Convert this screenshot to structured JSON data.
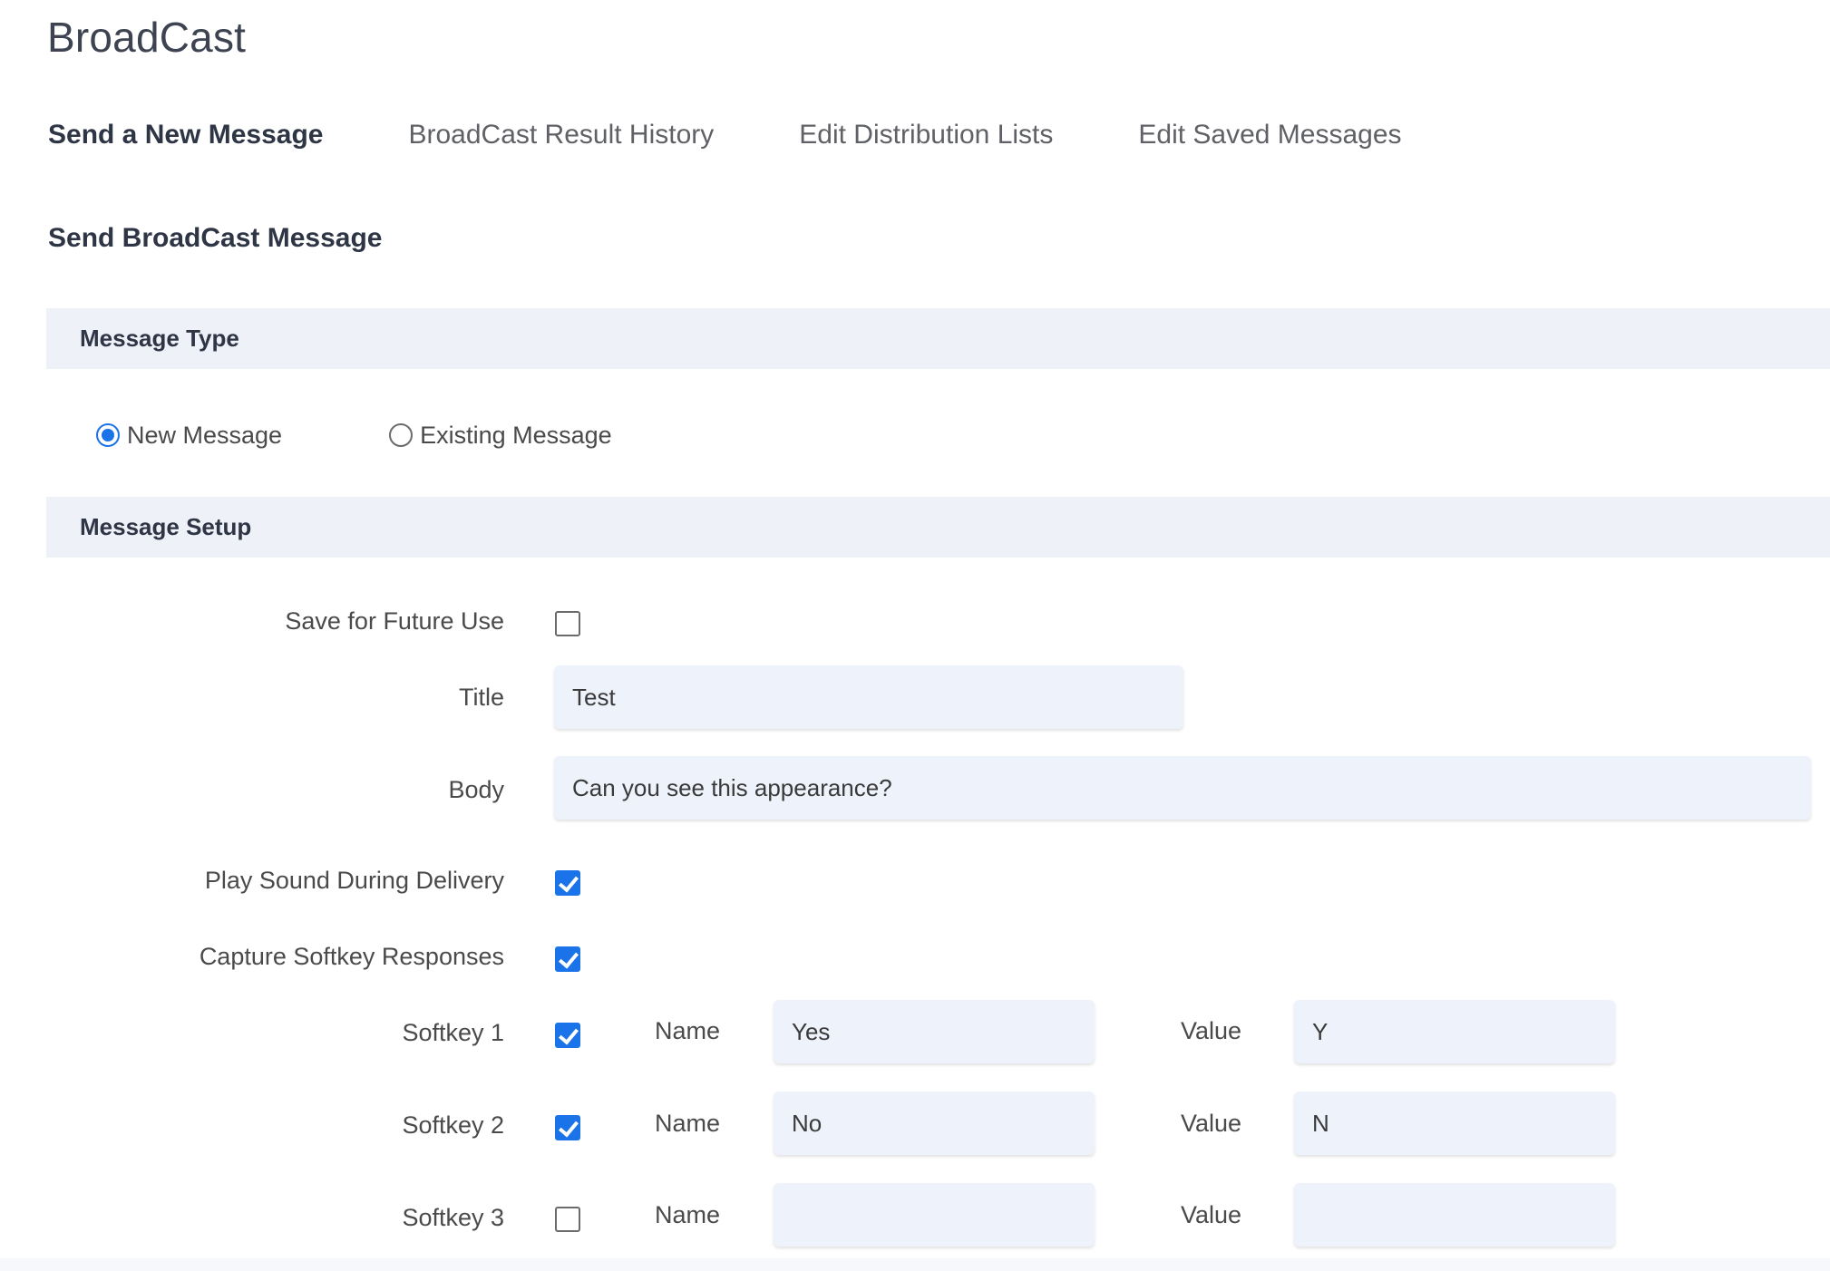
{
  "app": {
    "title": "BroadCast"
  },
  "tabs": [
    {
      "label": "Send a New Message",
      "active": true
    },
    {
      "label": "BroadCast Result History",
      "active": false
    },
    {
      "label": "Edit Distribution Lists",
      "active": false
    },
    {
      "label": "Edit Saved Messages",
      "active": false
    }
  ],
  "page": {
    "heading": "Send BroadCast Message"
  },
  "message_type": {
    "section_label": "Message Type",
    "options": [
      {
        "label": "New Message",
        "selected": true
      },
      {
        "label": "Existing Message",
        "selected": false
      }
    ]
  },
  "message_setup": {
    "section_label": "Message Setup",
    "save_for_future": {
      "label": "Save for Future Use",
      "checked": false
    },
    "title": {
      "label": "Title",
      "value": "Test"
    },
    "body": {
      "label": "Body",
      "value": "Can you see this appearance?"
    },
    "play_sound": {
      "label": "Play Sound During Delivery",
      "checked": true
    },
    "capture_softkeys": {
      "label": "Capture Softkey Responses",
      "checked": true
    },
    "name_label": "Name",
    "value_label": "Value",
    "softkeys": [
      {
        "label": "Softkey 1",
        "checked": true,
        "name": "Yes",
        "value": "Y"
      },
      {
        "label": "Softkey 2",
        "checked": true,
        "name": "No",
        "value": "N"
      },
      {
        "label": "Softkey 3",
        "checked": false,
        "name": "",
        "value": ""
      }
    ]
  },
  "colors": {
    "accent": "#1a73e8",
    "band_background": "#eef1f8",
    "input_background": "#eef2fb",
    "heading_text": "#2e3545"
  }
}
